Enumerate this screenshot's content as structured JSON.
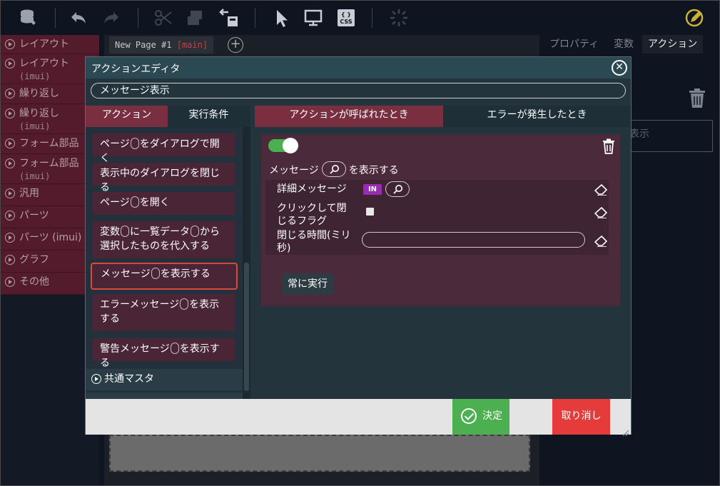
{
  "toolbar": {
    "icons": [
      "database-icon",
      "undo-icon",
      "redo-icon",
      "cut-icon",
      "copy-icon",
      "paste-icon",
      "pointer-icon",
      "monitor-icon",
      "css-icon",
      "loading-icon",
      "edit-icon"
    ],
    "css_label": "CSS",
    "accent_color": "#c9b23a"
  },
  "palette": {
    "items": [
      {
        "label": "レイアウト",
        "sub": ""
      },
      {
        "label": "レイアウト",
        "sub": "(imui)"
      },
      {
        "label": "繰り返し",
        "sub": ""
      },
      {
        "label": "繰り返し",
        "sub": "(imui)"
      },
      {
        "label": "フォーム部品",
        "sub": ""
      },
      {
        "label": "フォーム部品",
        "sub": "(imui)"
      },
      {
        "label": "汎用",
        "sub": ""
      },
      {
        "label": "パーツ",
        "sub": ""
      },
      {
        "label": "パーツ (imui)",
        "sub": ""
      },
      {
        "label": "グラフ",
        "sub": ""
      },
      {
        "label": "その他",
        "sub": ""
      }
    ]
  },
  "page_tab": {
    "name": "New Page #1",
    "branch": "[main]"
  },
  "right_panel": {
    "tabs": [
      "プロパティ",
      "変数",
      "アクション"
    ],
    "active_tab": "アクション",
    "ghost_text": "表示"
  },
  "dialog": {
    "title": "アクションエディタ",
    "name_value": "メッセージ表示",
    "left_tabs": [
      "アクション",
      "実行条件"
    ],
    "action_list": [
      {
        "parts": [
          "ページ",
          "をダイアログで開く"
        ]
      },
      {
        "parts": [
          "表示中のダイアログを閉じる"
        ]
      },
      {
        "parts": [
          "ページ",
          "を開く"
        ]
      },
      {
        "parts": [
          "変数",
          "に一覧データ",
          "から選択したものを代入する"
        ]
      },
      {
        "parts": [
          "メッセージ",
          "を表示する"
        ],
        "selected": true
      },
      {
        "parts": [
          "エラーメッセージ",
          "を表示する"
        ]
      },
      {
        "parts": [
          "警告メッセージ",
          "を表示する"
        ]
      }
    ],
    "category": "共通マスタ",
    "right_tabs": [
      "アクションが呼ばれたとき",
      "エラーが発生したとき"
    ],
    "card": {
      "enabled": true,
      "title_before": "メッセージ",
      "title_after": "を表示する",
      "params": [
        {
          "label": "詳細メッセージ",
          "badge": "IN"
        },
        {
          "label": "クリックして閉じるフラグ"
        },
        {
          "label": "閉じる時間(ミリ秒)"
        }
      ],
      "always_run_label": "常に実行"
    },
    "ok_label": "決定",
    "cancel_label": "取り消し"
  },
  "colors": {
    "toggle_on": "#4caf50",
    "ok": "#4caf50",
    "cancel": "#e53b3b",
    "selection_outline": "#e0473c",
    "active_tab": "#7a2f40"
  }
}
